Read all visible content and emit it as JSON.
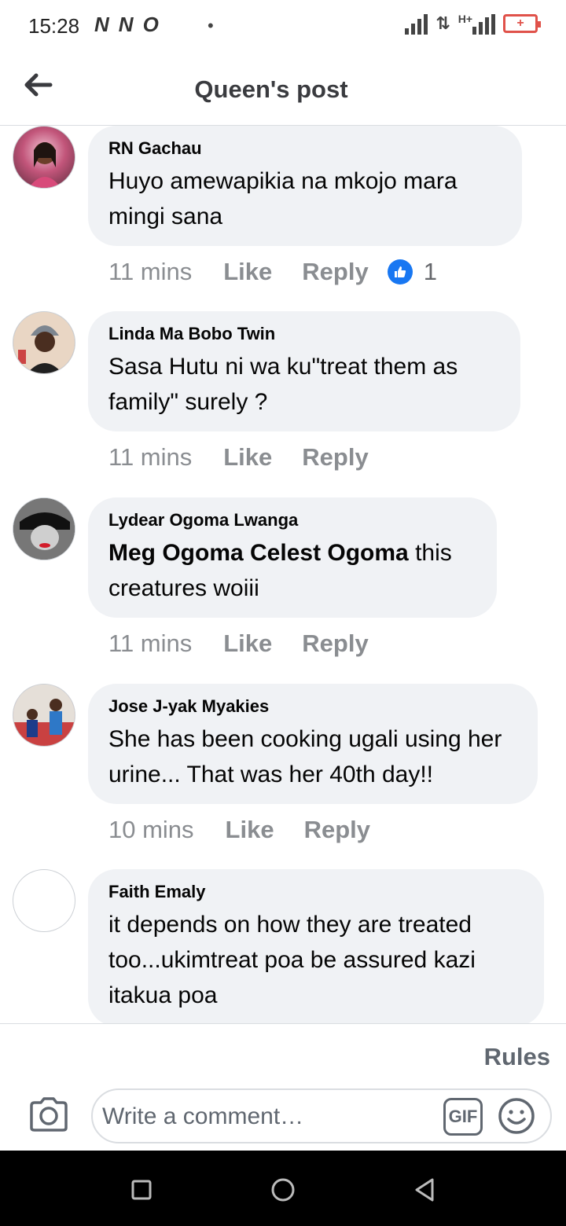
{
  "status_bar": {
    "time": "15:28",
    "left_icons": [
      "N",
      "N",
      "O"
    ],
    "right_network": "H+"
  },
  "header": {
    "title": "Queen's post",
    "back_icon": "arrow-left-icon"
  },
  "comments": [
    {
      "author": "RN Gachau",
      "text": "Huyo amewapikia na mkojo mara mingi sana",
      "time": "11 mins",
      "like_label": "Like",
      "reply_label": "Reply",
      "reactions": "1",
      "avatar_color": "#c2557a"
    },
    {
      "author": "Linda Ma Bobo Twin",
      "text": "Sasa Hutu ni wa ku\"treat them as family\" surely ?",
      "time": "11 mins",
      "like_label": "Like",
      "reply_label": "Reply",
      "avatar_color": "#9aa3ad"
    },
    {
      "author": "Lydear Ogoma Lwanga",
      "mention": "Meg Ogoma Celest Ogoma",
      "text": " this creatures woiii",
      "time": "11 mins",
      "like_label": "Like",
      "reply_label": "Reply",
      "avatar_color": "#3a3a3a"
    },
    {
      "author": "Jose J-yak Myakies",
      "text": "She has been cooking ugali using her urine... That was her 40th day!!",
      "time": "10 mins",
      "like_label": "Like",
      "reply_label": "Reply",
      "avatar_color": "#c94141"
    },
    {
      "author": "Faith Emaly",
      "text": "it depends on how they are treated too...ukimtreat poa be assured kazi itakua poa",
      "avatar_color": "#ffffff"
    }
  ],
  "bottom": {
    "rules_label": "Rules",
    "input_placeholder": "Write a comment…",
    "gif_label": "GIF"
  },
  "colors": {
    "bubble": "#f0f2f5",
    "meta_text": "#8a8d91",
    "like_blue": "#1877f2"
  }
}
